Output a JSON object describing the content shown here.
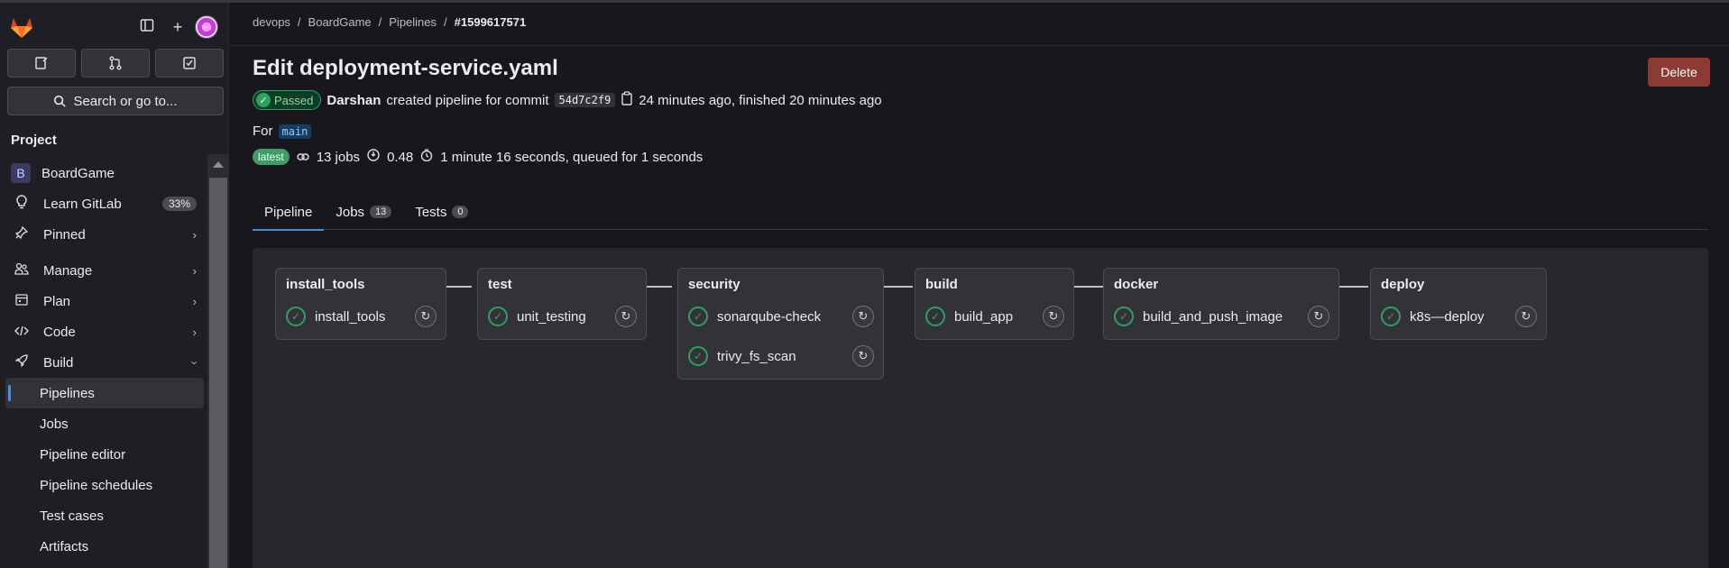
{
  "sidebar": {
    "section_title": "Project",
    "search_label": "Search or go to...",
    "project_name": "BoardGame",
    "project_initial": "B",
    "items": [
      {
        "label": "Learn GitLab",
        "icon": "bulb-icon",
        "badge": "33%"
      },
      {
        "label": "Pinned",
        "icon": "pin-icon"
      },
      {
        "label": "Manage",
        "icon": "users-icon"
      },
      {
        "label": "Plan",
        "icon": "calendar-icon"
      },
      {
        "label": "Code",
        "icon": "code-icon"
      },
      {
        "label": "Build",
        "icon": "rocket-icon"
      }
    ],
    "build_subitems": [
      "Pipelines",
      "Jobs",
      "Pipeline editor",
      "Pipeline schedules",
      "Test cases",
      "Artifacts"
    ]
  },
  "breadcrumb": [
    "devops",
    "BoardGame",
    "Pipelines",
    "#1599617571"
  ],
  "page": {
    "title": "Edit deployment-service.yaml",
    "delete_label": "Delete",
    "status": "Passed",
    "author": "Darshan",
    "created_text": "created pipeline for commit",
    "commit": "54d7c2f9",
    "time_text": "24 minutes ago, finished 20 minutes ago",
    "for_label": "For",
    "branch": "main",
    "latest_label": "latest",
    "jobs_count_text": "13 jobs",
    "coverage": "0.48",
    "duration_text": "1 minute 16 seconds, queued for 1 seconds"
  },
  "tabs": [
    {
      "label": "Pipeline"
    },
    {
      "label": "Jobs",
      "count": "13"
    },
    {
      "label": "Tests",
      "count": "0"
    }
  ],
  "stages": [
    {
      "name": "install_tools",
      "jobs": [
        "install_tools"
      ]
    },
    {
      "name": "test",
      "jobs": [
        "unit_testing"
      ]
    },
    {
      "name": "security",
      "jobs": [
        "sonarqube-check",
        "trivy_fs_scan"
      ]
    },
    {
      "name": "build",
      "jobs": [
        "build_app"
      ]
    },
    {
      "name": "docker",
      "jobs": [
        "build_and_push_image"
      ]
    },
    {
      "name": "deploy",
      "jobs": [
        "k8s—deploy"
      ]
    }
  ],
  "colors": {
    "accent": "#428fdc",
    "success": "#2da160",
    "danger": "#8d3a33"
  }
}
